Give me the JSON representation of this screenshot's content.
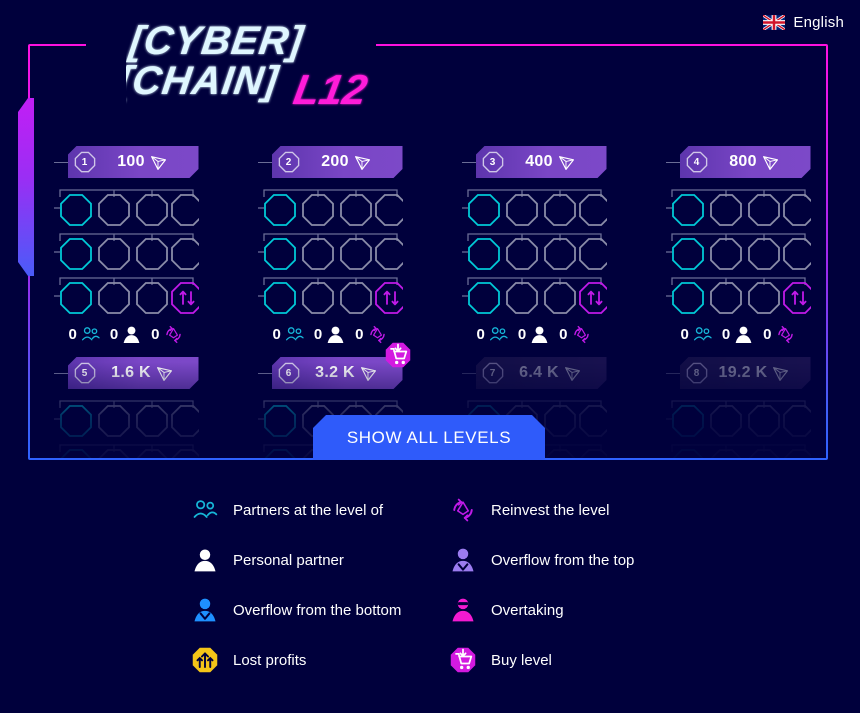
{
  "language": {
    "label": "English",
    "flag_icon": "uk-flag-icon"
  },
  "logo": {
    "line1": "CYBER",
    "line2": "CHAIN",
    "suffix": "L12"
  },
  "levels": {
    "row1": [
      {
        "number": "1",
        "price": "100",
        "currency_icon": "tron-icon",
        "locked": false,
        "buyable": false,
        "stats": [
          {
            "value": "0",
            "icon": "partners-group-icon"
          },
          {
            "value": "0",
            "icon": "personal-partner-icon"
          },
          {
            "value": "0",
            "icon": "reinvest-icon"
          }
        ]
      },
      {
        "number": "2",
        "price": "200",
        "currency_icon": "tron-icon",
        "locked": false,
        "buyable": false,
        "stats": [
          {
            "value": "0",
            "icon": "partners-group-icon"
          },
          {
            "value": "0",
            "icon": "personal-partner-icon"
          },
          {
            "value": "0",
            "icon": "reinvest-icon"
          }
        ]
      },
      {
        "number": "3",
        "price": "400",
        "currency_icon": "tron-icon",
        "locked": false,
        "buyable": false,
        "stats": [
          {
            "value": "0",
            "icon": "partners-group-icon"
          },
          {
            "value": "0",
            "icon": "personal-partner-icon"
          },
          {
            "value": "0",
            "icon": "reinvest-icon"
          }
        ]
      },
      {
        "number": "4",
        "price": "800",
        "currency_icon": "tron-icon",
        "locked": false,
        "buyable": false,
        "stats": [
          {
            "value": "0",
            "icon": "partners-group-icon"
          },
          {
            "value": "0",
            "icon": "personal-partner-icon"
          },
          {
            "value": "0",
            "icon": "reinvest-icon"
          }
        ]
      }
    ],
    "row2": [
      {
        "number": "5",
        "price": "1.6 K",
        "currency_icon": "tron-icon",
        "locked": false,
        "buyable": false
      },
      {
        "number": "6",
        "price": "3.2 K",
        "currency_icon": "tron-icon",
        "locked": false,
        "buyable": true,
        "buy_icon": "buy-level-cart-icon"
      },
      {
        "number": "7",
        "price": "6.4 K",
        "currency_icon": "tron-icon",
        "locked": true,
        "buyable": false
      },
      {
        "number": "8",
        "price": "19.2 K",
        "currency_icon": "tron-icon",
        "locked": true,
        "buyable": false
      }
    ]
  },
  "show_all_button": {
    "label": "SHOW ALL LEVELS"
  },
  "legend": {
    "left": [
      {
        "label": "Partners at the level of",
        "icon": "partners-group-icon"
      },
      {
        "label": "Personal partner",
        "icon": "personal-partner-icon"
      },
      {
        "label": "Overflow from the bottom",
        "icon": "overflow-bottom-icon"
      },
      {
        "label": "Lost profits",
        "icon": "lost-profits-icon"
      }
    ],
    "right": [
      {
        "label": "Reinvest the level",
        "icon": "reinvest-icon"
      },
      {
        "label": "Overflow from the top",
        "icon": "overflow-top-icon"
      },
      {
        "label": "Overtaking",
        "icon": "overtaking-icon"
      },
      {
        "label": "Buy level",
        "icon": "buy-level-cart-icon"
      }
    ]
  },
  "colors": {
    "background": "#00003c",
    "accent_magenta": "#e018ec",
    "accent_blue": "#2f5bfa",
    "accent_cyan": "#00c9d6",
    "accent_purple": "#7a46c6",
    "node_gray": "#8a8ca8"
  }
}
